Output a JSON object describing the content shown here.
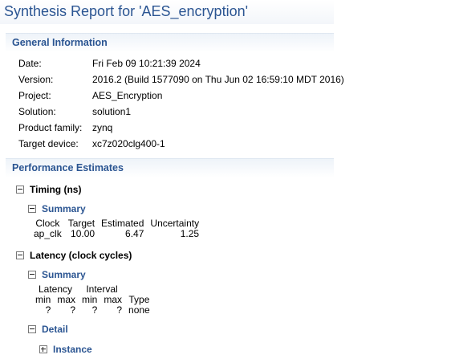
{
  "title": "Synthesis Report for 'AES_encryption'",
  "general": {
    "header": "General Information",
    "rows": [
      {
        "label": "Date:",
        "value": "Fri Feb 09 10:21:39 2024"
      },
      {
        "label": "Version:",
        "value": "2016.2 (Build 1577090 on Thu Jun 02 16:59:10 MDT 2016)"
      },
      {
        "label": "Project:",
        "value": "AES_Encryption"
      },
      {
        "label": "Solution:",
        "value": "solution1"
      },
      {
        "label": "Product family:",
        "value": "zynq"
      },
      {
        "label": "Target device:",
        "value": "xc7z020clg400-1"
      }
    ]
  },
  "performance": {
    "header": "Performance Estimates",
    "timing": {
      "label": "Timing (ns)",
      "summary_label": "Summary",
      "columns": [
        "Clock",
        "Target",
        "Estimated",
        "Uncertainty"
      ],
      "row": [
        "ap_clk",
        "10.00",
        "6.47",
        "1.25"
      ]
    },
    "latency": {
      "label": "Latency (clock cycles)",
      "summary_label": "Summary",
      "group_headers": [
        "Latency",
        "Interval"
      ],
      "columns": [
        "min",
        "max",
        "min",
        "max",
        "Type"
      ],
      "row": [
        "?",
        "?",
        "?",
        "?",
        "none"
      ],
      "detail_label": "Detail",
      "instance_label": "Instance"
    }
  }
}
